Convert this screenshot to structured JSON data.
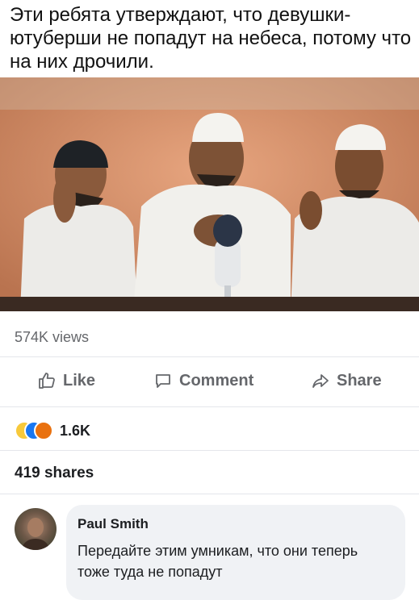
{
  "meme": {
    "caption": "Эти ребята утверждают, что девушки-ютуберши не попадут на небеса, потому что на них дрочили."
  },
  "post": {
    "views": "574K views",
    "actions": {
      "like": "Like",
      "comment": "Comment",
      "share": "Share"
    },
    "reactions_count": "1.6K",
    "shares": "419 shares"
  },
  "comment": {
    "author": "Paul Smith",
    "text": "Передайте этим умникам, что они теперь тоже туда не попадут"
  }
}
